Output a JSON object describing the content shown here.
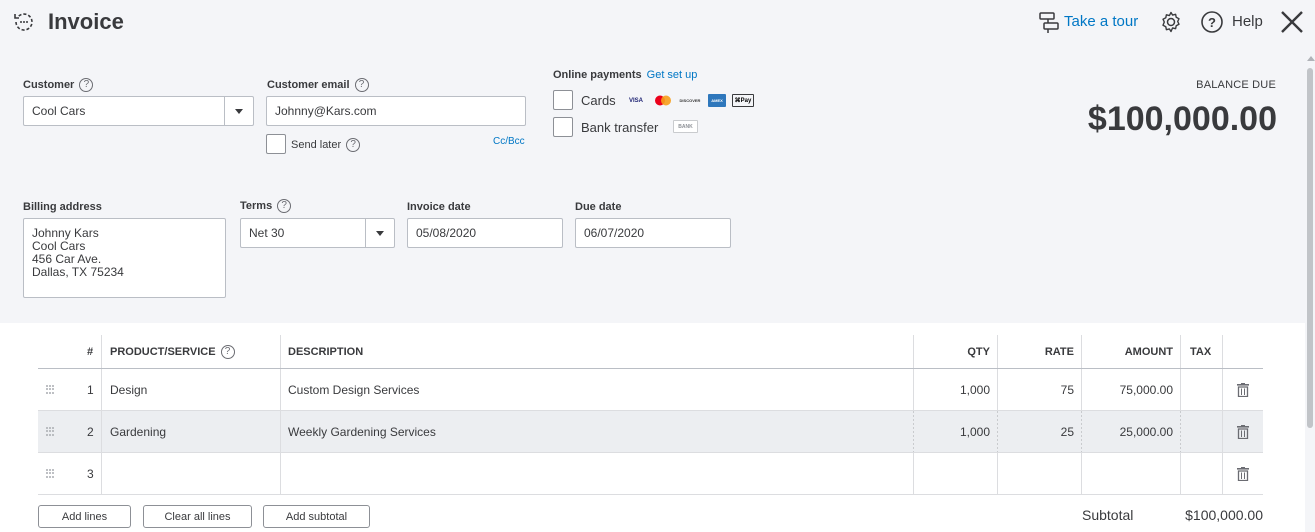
{
  "header": {
    "title": "Invoice",
    "tour_label": "Take a tour",
    "help_label": "Help"
  },
  "customer": {
    "label": "Customer",
    "value": "Cool Cars"
  },
  "email": {
    "label": "Customer email",
    "value": "Johnny@Kars.com",
    "send_later_label": "Send later",
    "cc_bcc_label": "Cc/Bcc"
  },
  "online_payments": {
    "label": "Online payments",
    "setup_link": "Get set up",
    "cards_label": "Cards",
    "bank_label": "Bank transfer",
    "card_logos": [
      "VISA",
      "",
      "DISCOVER",
      "AMEX",
      "⌘Pay"
    ],
    "bank_logo": "BANK"
  },
  "balance": {
    "label": "BALANCE DUE",
    "amount": "$100,000.00"
  },
  "billing": {
    "label": "Billing address",
    "lines": [
      "Johnny Kars",
      "Cool Cars",
      "456 Car Ave.",
      "Dallas, TX  75234"
    ]
  },
  "terms": {
    "label": "Terms",
    "value": "Net 30"
  },
  "invoice_date": {
    "label": "Invoice date",
    "value": "05/08/2020"
  },
  "due_date": {
    "label": "Due date",
    "value": "06/07/2020"
  },
  "table": {
    "headers": {
      "num": "#",
      "product": "PRODUCT/SERVICE",
      "description": "DESCRIPTION",
      "qty": "QTY",
      "rate": "RATE",
      "amount": "AMOUNT",
      "tax": "TAX"
    },
    "rows": [
      {
        "num": "1",
        "product": "Design",
        "description": "Custom Design Services",
        "qty": "1,000",
        "rate": "75",
        "amount": "75,000.00"
      },
      {
        "num": "2",
        "product": "Gardening",
        "description": "Weekly Gardening Services",
        "qty": "1,000",
        "rate": "25",
        "amount": "25,000.00"
      },
      {
        "num": "3",
        "product": "",
        "description": "",
        "qty": "",
        "rate": "",
        "amount": ""
      }
    ]
  },
  "footer": {
    "add_lines": "Add lines",
    "clear_lines": "Clear all lines",
    "add_subtotal": "Add subtotal",
    "subtotal_label": "Subtotal",
    "subtotal_value": "$100,000.00"
  },
  "colors": {
    "panel_bg": "#f4f5f8",
    "link": "#0077c5",
    "text": "#393a3d",
    "row_alt": "#eceef1"
  }
}
